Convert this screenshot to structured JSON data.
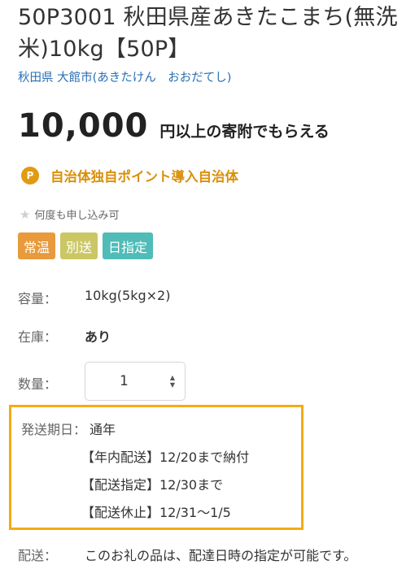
{
  "product": {
    "title": "50P3001 秋田県産あきたこまち(無洗米)10kg【50P】",
    "location": "秋田県 大館市(あきたけん　おおだてし)"
  },
  "price": {
    "amount": "10,000",
    "suffix": "円以上の寄附でもらえる"
  },
  "point": {
    "icon_letter": "P",
    "text": "自治体独自ポイント導入自治体"
  },
  "repeat": {
    "icon": "star-icon",
    "text": "何度も申し込み可"
  },
  "tags": [
    {
      "label": "常温",
      "color": "#e89a3c"
    },
    {
      "label": "別送",
      "color": "#cbc764"
    },
    {
      "label": "日指定",
      "color": "#4fbcb8"
    }
  ],
  "specs": {
    "capacity_label": "容量：",
    "capacity_value": "10kg(5kg×2)",
    "stock_label": "在庫：",
    "stock_value": "あり",
    "quantity_label": "数量：",
    "quantity_value": "1"
  },
  "shipping": {
    "label": "発送期日：",
    "lines": [
      "通年",
      "【年内配送】12/20まで納付",
      "【配送指定】12/30まで",
      "【配送休止】12/31～1/5"
    ],
    "highlight_color": "#f5ab16"
  },
  "delivery": {
    "label": "配送：",
    "value": "このお礼の品は、配達日時の指定が可能です。"
  }
}
